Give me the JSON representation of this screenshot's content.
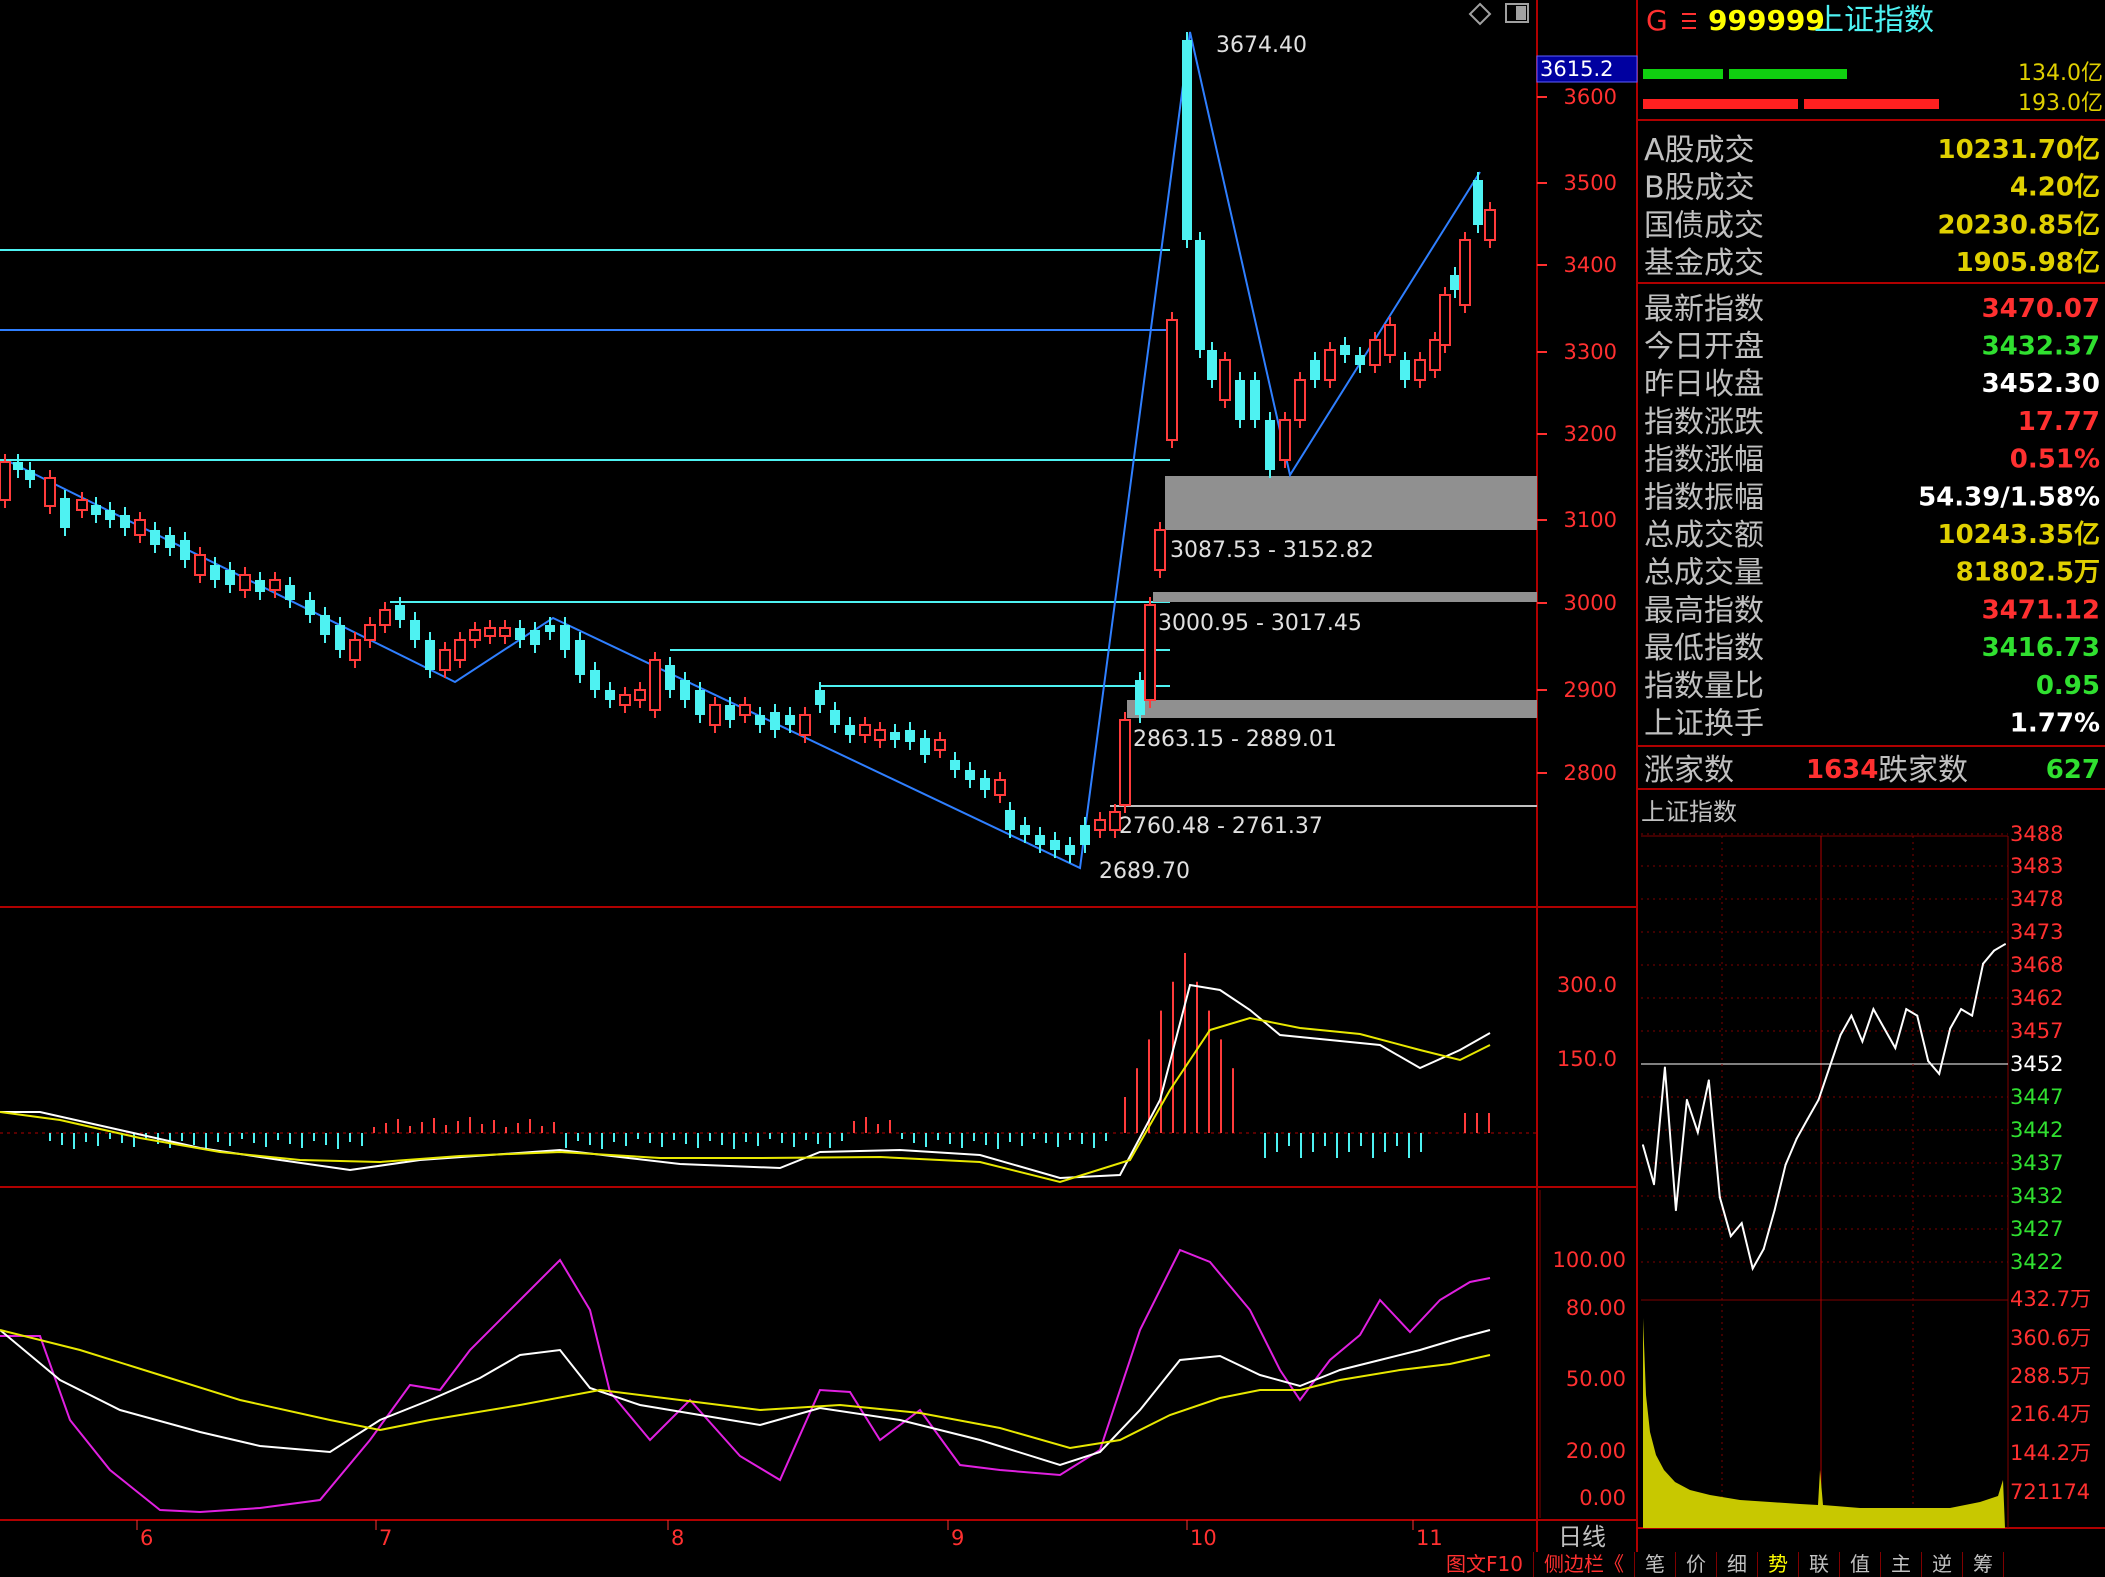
{
  "header": {
    "g_mark": "G",
    "menu_icon": "menu-lines-icon",
    "code": "999999",
    "name": "上证指数",
    "toolbar_icons": [
      "diamond-icon",
      "window-toggle-icon"
    ]
  },
  "bars": {
    "green_value": "134.0亿",
    "red_value": "193.0亿"
  },
  "stats": [
    {
      "label": "A股成交",
      "value": "10231.70亿",
      "color": "#e0d000"
    },
    {
      "label": "B股成交",
      "value": "4.20亿",
      "color": "#e0d000"
    },
    {
      "label": "国债成交",
      "value": "20230.85亿",
      "color": "#e0d000"
    },
    {
      "label": "基金成交",
      "value": "1905.98亿",
      "color": "#e0d000"
    },
    {
      "label": "最新指数",
      "value": "3470.07",
      "color": "#ff3030"
    },
    {
      "label": "今日开盘",
      "value": "3432.37",
      "color": "#30e030"
    },
    {
      "label": "昨日收盘",
      "value": "3452.30",
      "color": "#ffffff"
    },
    {
      "label": "指数涨跌",
      "value": "17.77",
      "color": "#ff3030"
    },
    {
      "label": "指数涨幅",
      "value": "0.51%",
      "color": "#ff3030"
    },
    {
      "label": "指数振幅",
      "value": "54.39/1.58%",
      "color": "#ffffff"
    },
    {
      "label": "总成交额",
      "value": "10243.35亿",
      "color": "#e0d000"
    },
    {
      "label": "总成交量",
      "value": "81802.5万",
      "color": "#e0d000"
    },
    {
      "label": "最高指数",
      "value": "3471.12",
      "color": "#ff3030"
    },
    {
      "label": "最低指数",
      "value": "3416.73",
      "color": "#30e030"
    },
    {
      "label": "指数量比",
      "value": "0.95",
      "color": "#30e030"
    },
    {
      "label": "上证换手",
      "value": "1.77%",
      "color": "#ffffff"
    }
  ],
  "breadth": {
    "up_label": "涨家数",
    "up_value": "1634",
    "down_label": "跌家数",
    "down_value": "627"
  },
  "intraday": {
    "title": "上证指数",
    "price_ticks": [
      "3488",
      "3483",
      "3478",
      "3473",
      "3468",
      "3462",
      "3457",
      "3452",
      "3447",
      "3442",
      "3437",
      "3432",
      "3427",
      "3422"
    ],
    "volume_ticks": [
      "432.7万",
      "360.6万",
      "288.5万",
      "216.4万",
      "144.2万",
      "721174"
    ]
  },
  "kline": {
    "current_price_box": "3615.2",
    "price_axis": [
      "3600",
      "3500",
      "3400",
      "3300",
      "3200",
      "3100",
      "3000",
      "2900",
      "2800"
    ],
    "high_label": "3674.40",
    "low_label": "2689.70",
    "gap_labels": [
      "3087.53 - 3152.82",
      "3000.95 - 3017.45",
      "2863.15 - 2889.01",
      "2760.48 - 2761.37"
    ],
    "macd_axis": [
      "300.0",
      "150.0"
    ],
    "kdj_axis": [
      "100.00",
      "80.00",
      "50.00",
      "20.00",
      "0.00"
    ],
    "months": [
      "6",
      "7",
      "8",
      "9",
      "10",
      "11"
    ],
    "period": "日线"
  },
  "tabs": [
    "图文F10",
    "侧边栏《",
    "笔",
    "价",
    "细",
    "势",
    "联",
    "值",
    "主",
    "逆",
    "筹"
  ],
  "colors": {
    "up": "#ff3b3b",
    "down": "#4ef2f2",
    "border": "#b00000",
    "trend": "#2f7fff",
    "yellow": "#e8e800",
    "magenta": "#e020e0"
  },
  "chart_data": [
    {
      "type": "line",
      "title": "上证指数",
      "series": [
        {
          "values": [
            3440,
            3434,
            3452,
            3430,
            3447,
            3442,
            3450,
            3432,
            3426,
            3428,
            3421,
            3424,
            3430,
            3437,
            3441,
            3444,
            3447,
            3452,
            3457,
            3460,
            3456,
            3461,
            3458,
            3455,
            3461,
            3460,
            3453,
            3451,
            3458,
            3461,
            3460,
            3468,
            3470,
            3471
          ]
        }
      ],
      "ylim": [
        3422,
        3488
      ]
    }
  ]
}
